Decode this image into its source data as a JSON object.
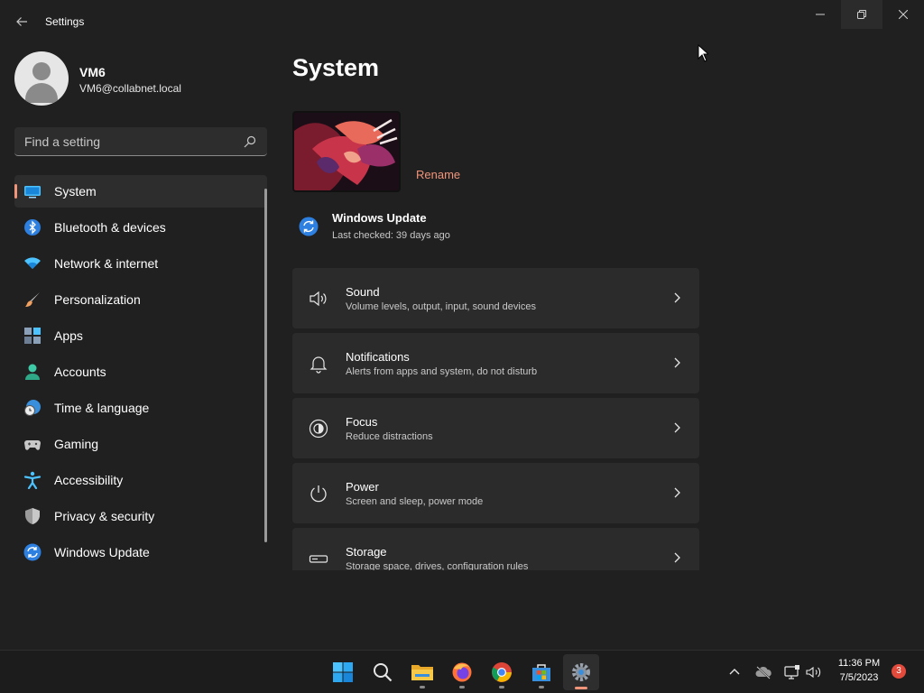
{
  "window": {
    "title": "Settings",
    "back_icon": "back-arrow-icon",
    "controls": [
      "minimize-icon",
      "restore-icon",
      "close-icon"
    ]
  },
  "user": {
    "name": "VM6",
    "email": "VM6@collabnet.local"
  },
  "search": {
    "placeholder": "Find a setting",
    "value": ""
  },
  "sidebar": {
    "items": [
      {
        "label": "System",
        "icon": "system-display-icon",
        "selected": true
      },
      {
        "label": "Bluetooth & devices",
        "icon": "bluetooth-icon"
      },
      {
        "label": "Network & internet",
        "icon": "wifi-icon"
      },
      {
        "label": "Personalization",
        "icon": "paintbrush-icon"
      },
      {
        "label": "Apps",
        "icon": "apps-icon"
      },
      {
        "label": "Accounts",
        "icon": "accounts-icon"
      },
      {
        "label": "Time & language",
        "icon": "globe-clock-icon"
      },
      {
        "label": "Gaming",
        "icon": "gamepad-icon"
      },
      {
        "label": "Accessibility",
        "icon": "accessibility-icon"
      },
      {
        "label": "Privacy & security",
        "icon": "shield-icon"
      },
      {
        "label": "Windows Update",
        "icon": "windows-update-icon"
      }
    ]
  },
  "main": {
    "title": "System",
    "rename_label": "Rename",
    "windows_update": {
      "title": "Windows Update",
      "subtitle": "Last checked: 39 days ago"
    },
    "cards": [
      {
        "title": "Sound",
        "subtitle": "Volume levels, output, input, sound devices",
        "icon": "speaker-icon"
      },
      {
        "title": "Notifications",
        "subtitle": "Alerts from apps and system, do not disturb",
        "icon": "bell-icon"
      },
      {
        "title": "Focus",
        "subtitle": "Reduce distractions",
        "icon": "focus-icon"
      },
      {
        "title": "Power",
        "subtitle": "Screen and sleep, power mode",
        "icon": "power-icon"
      },
      {
        "title": "Storage",
        "subtitle": "Storage space, drives, configuration rules",
        "icon": "storage-drive-icon"
      }
    ]
  },
  "taskbar": {
    "apps": [
      "start-icon",
      "search-icon",
      "file-explorer-icon",
      "firefox-icon",
      "chrome-icon",
      "microsoft-store-icon",
      "settings-icon"
    ],
    "active_app": "settings-icon",
    "time": "11:36 PM",
    "date": "7/5/2023",
    "notification_count": "3"
  },
  "colors": {
    "accent": "#f0947a",
    "background": "#202020",
    "card": "#2b2b2b"
  }
}
